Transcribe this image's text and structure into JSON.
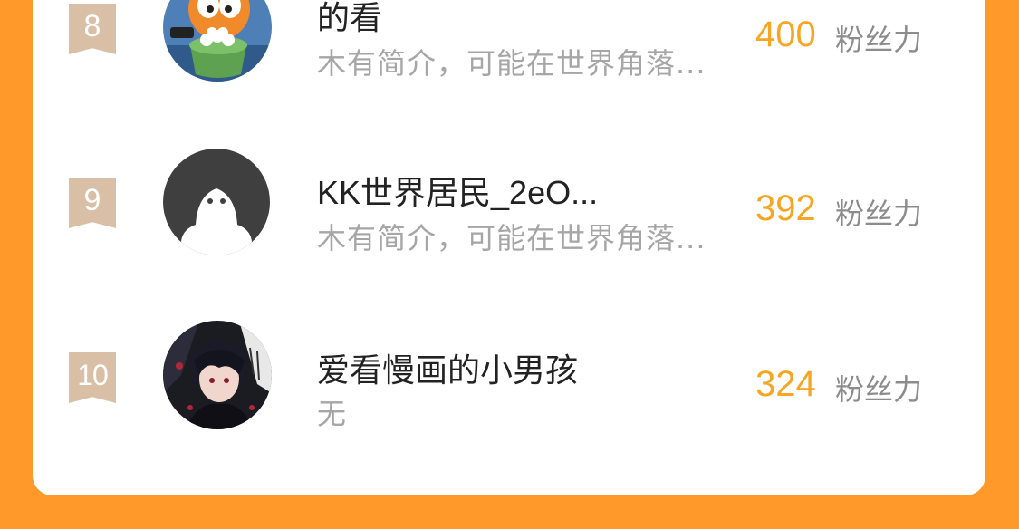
{
  "leaderboard": {
    "entries": [
      {
        "rank": "8",
        "name": "的看",
        "bio": "木有简介，可能在世界角落...",
        "score": "400",
        "score_unit": "粉丝力",
        "avatar": "garfield-popcorn-avatar"
      },
      {
        "rank": "9",
        "name": "KK世界居民_2eO...",
        "bio": "木有简介，可能在世界角落...",
        "score": "392",
        "score_unit": "粉丝力",
        "avatar": "default-ghost-avatar"
      },
      {
        "rank": "10",
        "name": "爱看慢画的小男孩",
        "bio": "无",
        "score": "324",
        "score_unit": "粉丝力",
        "avatar": "anime-boy-avatar"
      }
    ]
  },
  "colors": {
    "page_background": "#FF9A2A",
    "card_background": "#FFFFFF",
    "rank_badge": "#D9BFA5",
    "score": "#F6A623",
    "name": "#222222",
    "bio": "#A6A6A6"
  }
}
